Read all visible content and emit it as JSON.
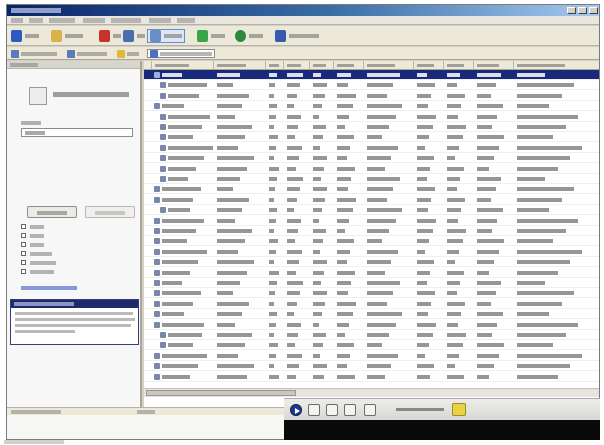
{
  "app": {
    "title": ""
  },
  "toolbar": {
    "buttons": [
      {
        "icon": "save-icon",
        "color": "#2d59c2"
      },
      {
        "icon": "folder-icon",
        "color": "#d9b24a"
      },
      {
        "icon": "remove-icon",
        "color": "#c8322a"
      },
      {
        "icon": "grid-icon",
        "color": "#4a6fae"
      },
      {
        "icon": "search-icon",
        "color": "#6a8cc7"
      },
      {
        "icon": "refresh-icon",
        "color": "#3aa548"
      },
      {
        "icon": "help-icon",
        "color": "#2a8a3a"
      },
      {
        "icon": "media-icon",
        "color": "#3a5ab0"
      }
    ]
  },
  "left_panel": {
    "accent_color": "#1f2a6a"
  },
  "grid": {
    "selected_row_color": "#1a2a7a",
    "selected_row_index": 0
  },
  "player": {
    "accent_color": "#e9d14a"
  }
}
